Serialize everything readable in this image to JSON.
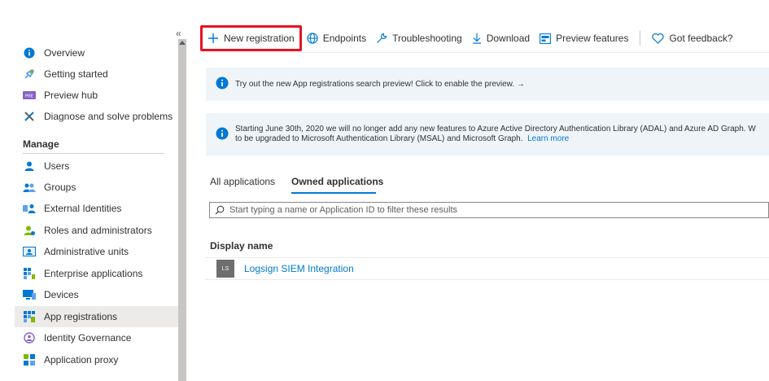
{
  "sidebar": {
    "collapse_glyph": "«",
    "items": [
      {
        "label": "Overview",
        "icon": "info-icon"
      },
      {
        "label": "Getting started",
        "icon": "rocket-icon"
      },
      {
        "label": "Preview hub",
        "icon": "preview-icon"
      },
      {
        "label": "Diagnose and solve problems",
        "icon": "wrench-icon"
      }
    ],
    "section": "Manage",
    "manage_items": [
      {
        "label": "Users",
        "icon": "user-icon"
      },
      {
        "label": "Groups",
        "icon": "group-icon"
      },
      {
        "label": "External Identities",
        "icon": "external-identities-icon"
      },
      {
        "label": "Roles and administrators",
        "icon": "roles-icon"
      },
      {
        "label": "Administrative units",
        "icon": "admin-units-icon"
      },
      {
        "label": "Enterprise applications",
        "icon": "enterprise-apps-icon"
      },
      {
        "label": "Devices",
        "icon": "devices-icon"
      },
      {
        "label": "App registrations",
        "icon": "app-registrations-icon",
        "selected": true
      },
      {
        "label": "Identity Governance",
        "icon": "identity-governance-icon"
      },
      {
        "label": "Application proxy",
        "icon": "app-proxy-icon"
      }
    ]
  },
  "toolbar": {
    "new_registration": "New registration",
    "endpoints": "Endpoints",
    "troubleshooting": "Troubleshooting",
    "download": "Download",
    "preview_features": "Preview features",
    "got_feedback": "Got feedback?"
  },
  "banners": {
    "preview_text": "Try out the new App registrations search preview! Click to enable the preview. →",
    "adal_line1": "Starting June 30th, 2020 we will no longer add any new features to Azure Active Directory Authentication Library (ADAL) and Azure AD Graph. W",
    "adal_line2": "to be upgraded to Microsoft Authentication Library (MSAL) and Microsoft Graph.",
    "learn_more": "Learn more"
  },
  "tabs": {
    "all": "All applications",
    "owned": "Owned applications"
  },
  "filter": {
    "placeholder": "Start typing a name or Application ID to filter these results"
  },
  "table": {
    "column_display_name": "Display name",
    "rows": [
      {
        "initials": "LS",
        "name": "Logsign SIEM Integration"
      }
    ]
  },
  "colors": {
    "accent": "#0078d4",
    "highlight_box": "#e81123",
    "banner_bg": "#eff4f9"
  }
}
